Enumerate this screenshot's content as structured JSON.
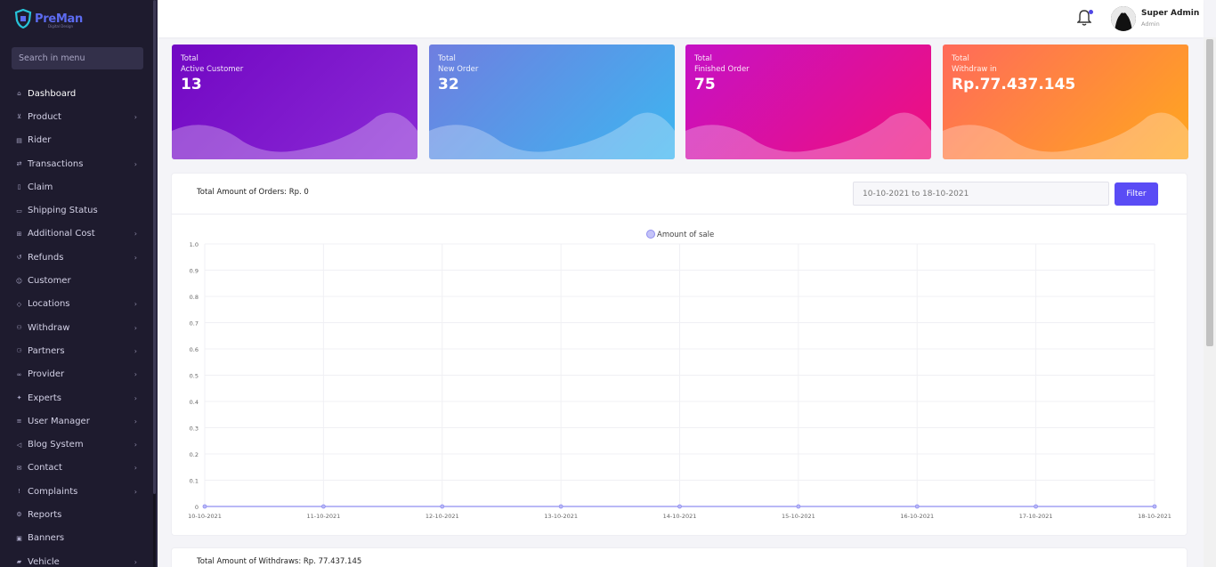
{
  "app": {
    "brand": "PreMan",
    "tagline": "Digital Design"
  },
  "search": {
    "placeholder": "Search in menu"
  },
  "sidebar": {
    "items": [
      {
        "label": "Dashboard",
        "icon": "home-icon",
        "has_children": false,
        "active": true
      },
      {
        "label": "Product",
        "icon": "cart-icon",
        "has_children": true
      },
      {
        "label": "Rider",
        "icon": "document-icon",
        "has_children": false
      },
      {
        "label": "Transactions",
        "icon": "transfer-icon",
        "has_children": true
      },
      {
        "label": "Claim",
        "icon": "file-icon",
        "has_children": false
      },
      {
        "label": "Shipping Status",
        "icon": "truck-icon",
        "has_children": false
      },
      {
        "label": "Additional Cost",
        "icon": "grid-icon",
        "has_children": true
      },
      {
        "label": "Refunds",
        "icon": "refund-icon",
        "has_children": true
      },
      {
        "label": "Customer",
        "icon": "users-icon",
        "has_children": false
      },
      {
        "label": "Locations",
        "icon": "pin-icon",
        "has_children": true
      },
      {
        "label": "Withdraw",
        "icon": "people-icon",
        "has_children": true
      },
      {
        "label": "Partners",
        "icon": "partners-icon",
        "has_children": true
      },
      {
        "label": "Provider",
        "icon": "link-icon",
        "has_children": true
      },
      {
        "label": "Experts",
        "icon": "expert-icon",
        "has_children": true
      },
      {
        "label": "User Manager",
        "icon": "list-icon",
        "has_children": true
      },
      {
        "label": "Blog System",
        "icon": "megaphone-icon",
        "has_children": true
      },
      {
        "label": "Contact",
        "icon": "mail-icon",
        "has_children": true
      },
      {
        "label": "Complaints",
        "icon": "alert-icon",
        "has_children": true
      },
      {
        "label": "Reports",
        "icon": "gear-icon",
        "has_children": false
      },
      {
        "label": "Banners",
        "icon": "image-icon",
        "has_children": false
      },
      {
        "label": "Vehicle",
        "icon": "vehicle-icon",
        "has_children": true
      }
    ]
  },
  "header": {
    "user_name": "Super Admin",
    "user_role": "Admin",
    "notification_dot": true
  },
  "stats": [
    {
      "line1": "Total",
      "line2": "Active Customer",
      "value": "13"
    },
    {
      "line1": "Total",
      "line2": "New Order",
      "value": "32"
    },
    {
      "line1": "Total",
      "line2": "Finished Order",
      "value": "75"
    },
    {
      "line1": "Total",
      "line2": "Withdraw in",
      "value": "Rp.77.437.145"
    }
  ],
  "orders_panel": {
    "title": "Total Amount of Orders: Rp. 0",
    "date_range": "10-10-2021 to 18-10-2021",
    "filter_label": "Filter"
  },
  "withdraws_panel": {
    "title": "Total Amount of Withdraws: Rp. 77.437.145"
  },
  "colors": {
    "sidebar_bg": "#1e1b2e",
    "accent": "#5a4cf5",
    "series_line": "#8f8ef0"
  },
  "chart_data": {
    "type": "line",
    "title": "",
    "xlabel": "",
    "ylabel": "",
    "categories": [
      "10-10-2021",
      "11-10-2021",
      "12-10-2021",
      "13-10-2021",
      "14-10-2021",
      "15-10-2021",
      "16-10-2021",
      "17-10-2021",
      "18-10-2021"
    ],
    "series": [
      {
        "name": "Amount of sale",
        "values": [
          0,
          0,
          0,
          0,
          0,
          0,
          0,
          0,
          0
        ]
      }
    ],
    "y_ticks": [
      "0",
      "0.1",
      "0.2",
      "0.3",
      "0.4",
      "0.5",
      "0.6",
      "0.7",
      "0.8",
      "0.9",
      "1.0"
    ],
    "ylim": [
      0,
      1.0
    ],
    "grid": true,
    "legend": "top"
  }
}
